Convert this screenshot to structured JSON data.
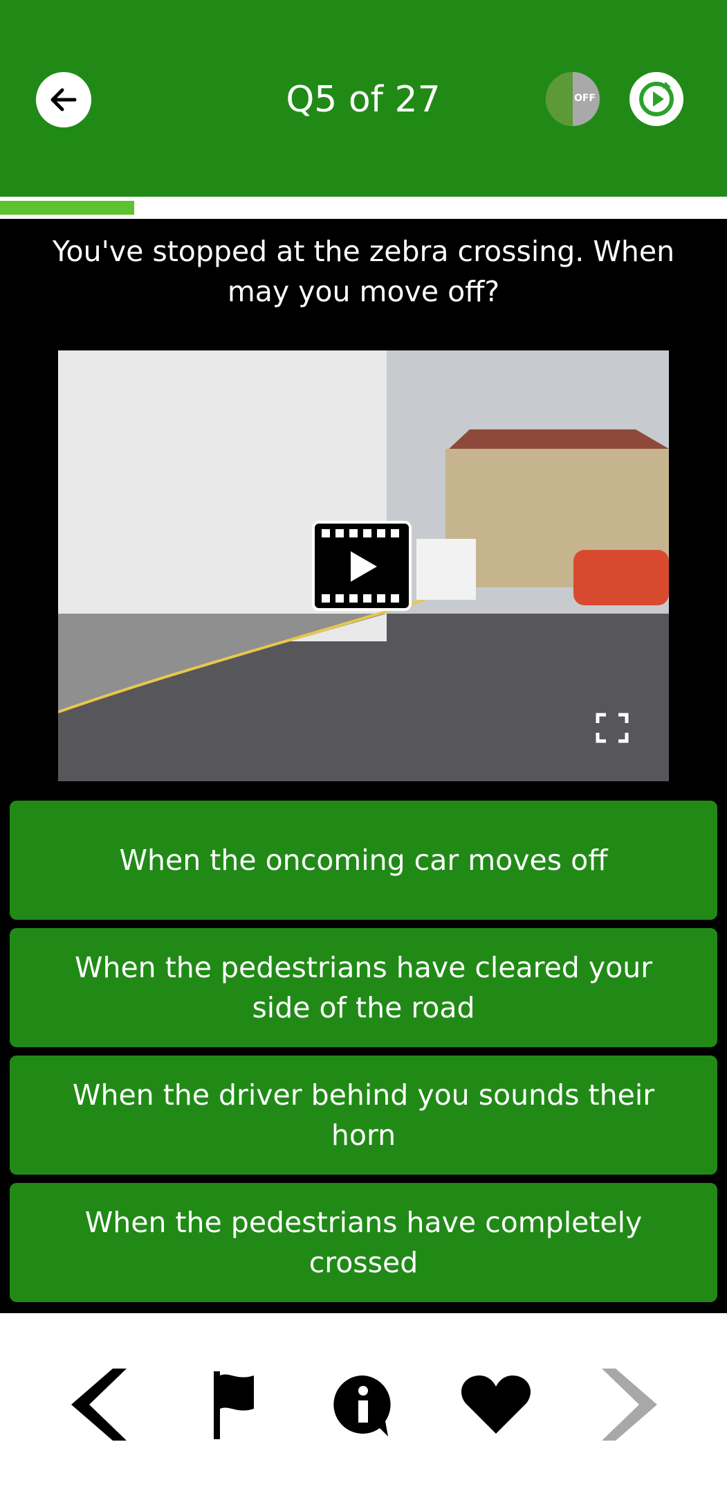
{
  "header": {
    "title": "Q5 of 27",
    "voice_toggle_label": "OFF",
    "background_color": "#218a17"
  },
  "progress": {
    "fraction": 0.185,
    "fill_color": "#5cc22d"
  },
  "question": {
    "text": "You've stopped at the zebra crossing. When may you move off?"
  },
  "answers": [
    "When the oncoming car moves off",
    "When the pedestrians have cleared your side of the road",
    "When the driver behind you sounds their horn",
    "When the pedestrians have completely crossed"
  ],
  "bottom_nav": {
    "icons": [
      "chevron-left-icon",
      "flag-icon",
      "info-icon",
      "heart-icon",
      "chevron-right-icon"
    ]
  }
}
